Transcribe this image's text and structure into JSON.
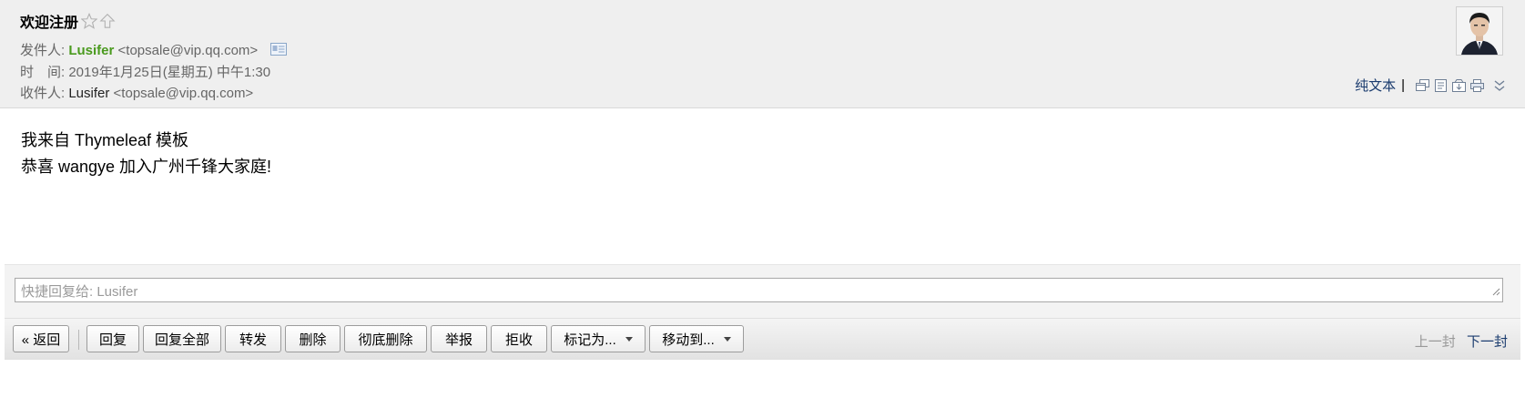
{
  "header": {
    "subject": "欢迎注册",
    "from_label": "发件人:",
    "from_name": "Lusifer",
    "from_addr": "<topsale@vip.qq.com>",
    "time_label": "时　间:",
    "time_value": "2019年1月25日(星期五) 中午1:30",
    "to_label": "收件人:",
    "to_name": "Lusifer",
    "to_addr": "<topsale@vip.qq.com>",
    "plain_text": "纯文本",
    "separator": "|"
  },
  "body": {
    "line1": "我来自 Thymeleaf 模板",
    "line2": "恭喜 wangye 加入广州千锋大家庭!"
  },
  "reply": {
    "placeholder": "快捷回复给: Lusifer"
  },
  "toolbar": {
    "back": "« 返回",
    "reply": "回复",
    "reply_all": "回复全部",
    "forward": "转发",
    "delete": "删除",
    "delete_permanent": "彻底删除",
    "report": "举报",
    "reject": "拒收",
    "mark_as": "标记为...",
    "move_to": "移动到...",
    "prev": "上一封",
    "next": "下一封"
  }
}
